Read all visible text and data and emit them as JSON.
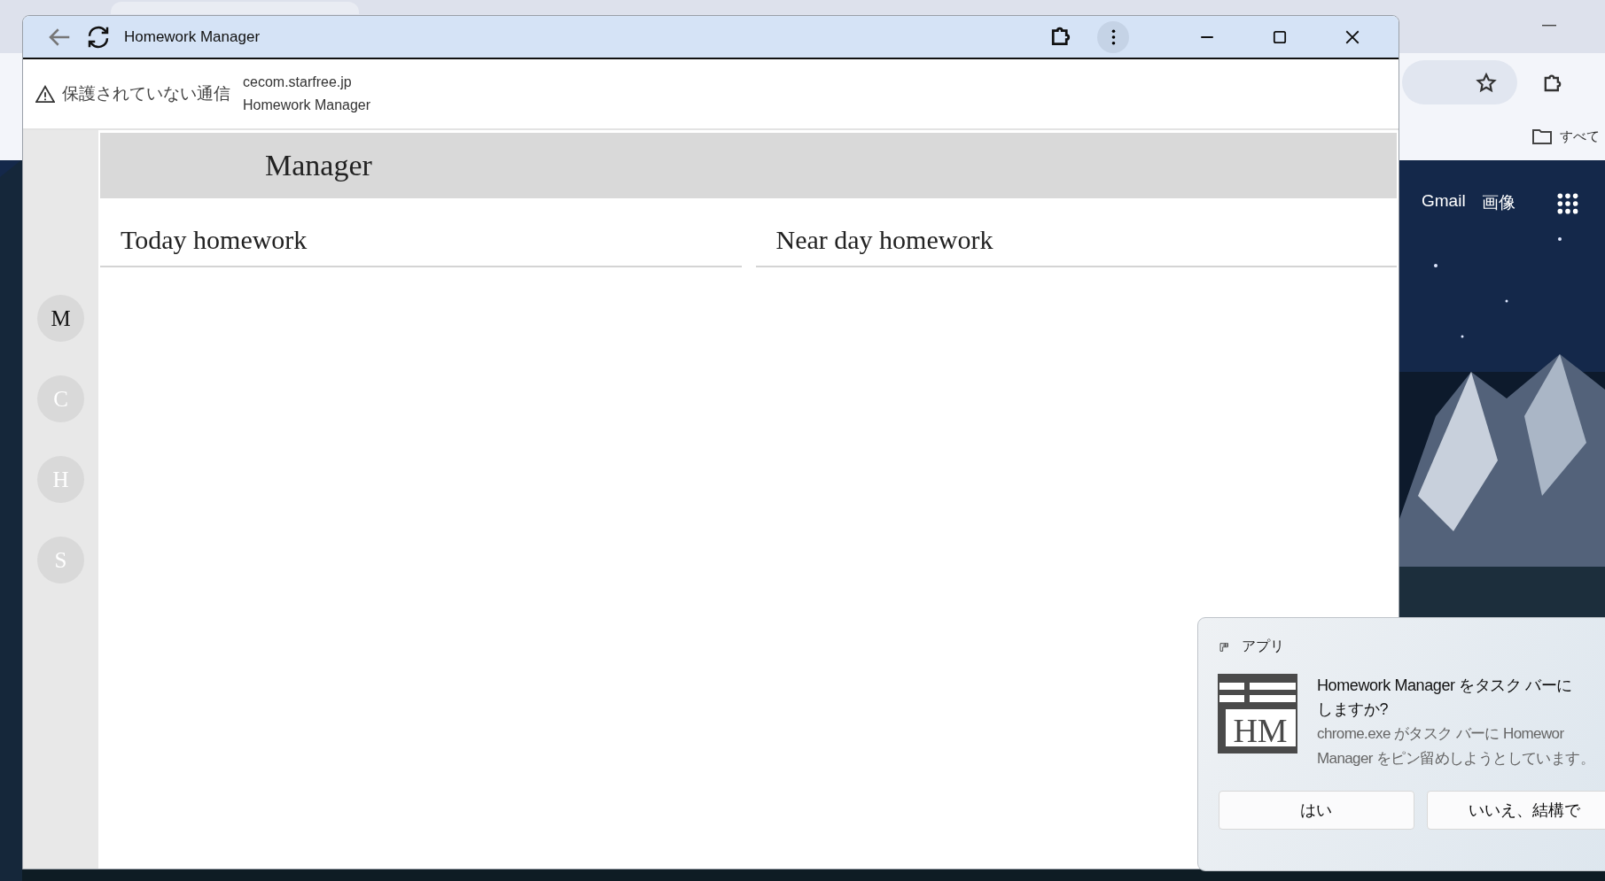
{
  "background_browser": {
    "bookmark": "すべて",
    "links": [
      "Gmail",
      "画像"
    ]
  },
  "app_window": {
    "title": "Homework Manager",
    "security_label": "保護されていない通信",
    "url": "cecom.starfree.jp",
    "page_title": "Homework Manager",
    "header": "Manager",
    "nav": [
      {
        "label": "M",
        "selected": true
      },
      {
        "label": "C",
        "selected": false
      },
      {
        "label": "H",
        "selected": false
      },
      {
        "label": "S",
        "selected": false
      }
    ],
    "sections": [
      "Today homework",
      "Near day homework"
    ]
  },
  "notification": {
    "source": "アプリ",
    "logo_text": "HM",
    "heading_lines": [
      "Homework Manager をタスク バーに",
      "しますか?"
    ],
    "body_lines": [
      "chrome.exe がタスク バーに Homewor",
      "Manager をピン留めしようとしています。"
    ],
    "buttons": [
      "はい",
      "いいえ、結構で"
    ]
  }
}
